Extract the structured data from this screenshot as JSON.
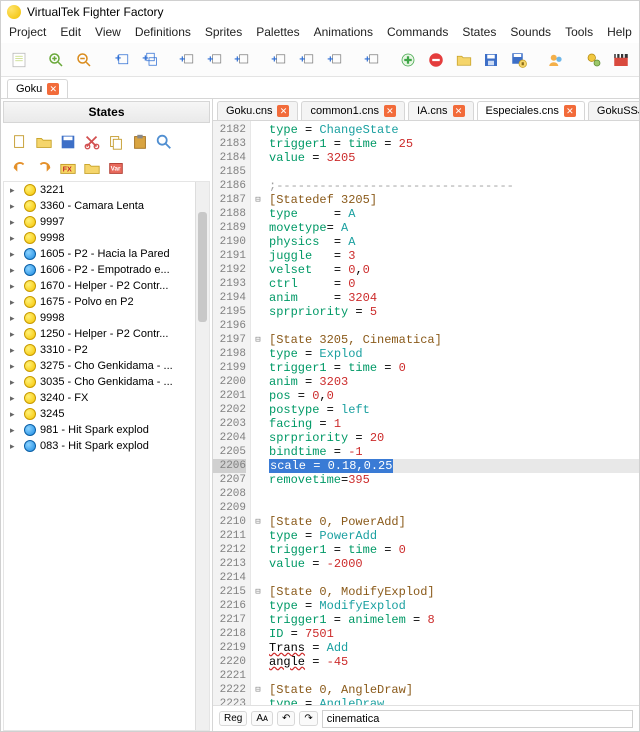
{
  "titlebar": {
    "app_title": "VirtualTek Fighter Factory"
  },
  "menus": [
    "Project",
    "Edit",
    "View",
    "Definitions",
    "Sprites",
    "Palettes",
    "Animations",
    "Commands",
    "States",
    "Sounds",
    "Tools",
    "Help"
  ],
  "top_tabs": [
    {
      "label": "Goku",
      "active": true
    }
  ],
  "states_panel": {
    "title": "States",
    "items": [
      {
        "icon": "yellow",
        "label": "3221"
      },
      {
        "icon": "yellow",
        "label": "3360 - Camara Lenta"
      },
      {
        "icon": "yellow",
        "label": "9997"
      },
      {
        "icon": "yellow",
        "label": "9998"
      },
      {
        "icon": "blue",
        "label": "1605 - P2 - Hacia la Pared"
      },
      {
        "icon": "blue",
        "label": "1606 - P2 - Empotrado e..."
      },
      {
        "icon": "yellow",
        "label": "1670 - Helper - P2 Contr..."
      },
      {
        "icon": "yellow",
        "label": "1675 - Polvo en P2"
      },
      {
        "icon": "yellow",
        "label": "9998"
      },
      {
        "icon": "yellow",
        "label": "1250 - Helper - P2 Contr..."
      },
      {
        "icon": "yellow",
        "label": "3310 - P2"
      },
      {
        "icon": "yellow",
        "label": "3275 - Cho Genkidama - ..."
      },
      {
        "icon": "yellow",
        "label": "3035 - Cho Genkidama - ..."
      },
      {
        "icon": "yellow",
        "label": "3240 - FX"
      },
      {
        "icon": "yellow",
        "label": "3245"
      },
      {
        "icon": "blue",
        "label": "981 - Hit Spark  explod"
      },
      {
        "icon": "blue",
        "label": "083 - Hit Spark  explod"
      }
    ]
  },
  "editor_tabs": [
    {
      "label": "Goku.cns",
      "active": false
    },
    {
      "label": "common1.cns",
      "active": false
    },
    {
      "label": "IA.cns",
      "active": false
    },
    {
      "label": "Especiales.cns",
      "active": true
    },
    {
      "label": "GokuSSJ.cns",
      "active": false
    }
  ],
  "code": {
    "first_line": 2182,
    "selected_line": 2206,
    "fold_lines": [
      2187,
      2197,
      2210,
      2215,
      2222
    ],
    "lines": [
      [
        [
          "green",
          "type"
        ],
        [
          "",
          " = "
        ],
        [
          "teal",
          "ChangeState"
        ]
      ],
      [
        [
          "green",
          "trigger1"
        ],
        [
          "",
          " = "
        ],
        [
          "green",
          "time"
        ],
        [
          "",
          " = "
        ],
        [
          "red",
          "25"
        ]
      ],
      [
        [
          "green",
          "value"
        ],
        [
          "",
          " = "
        ],
        [
          "red",
          "3205"
        ]
      ],
      [
        [
          "",
          ""
        ]
      ],
      [
        [
          "gray",
          ";---------------------------------"
        ]
      ],
      [
        [
          "brown",
          "[Statedef 3205]"
        ]
      ],
      [
        [
          "green",
          "type"
        ],
        [
          "",
          "     = "
        ],
        [
          "teal",
          "A"
        ]
      ],
      [
        [
          "green",
          "movetype"
        ],
        [
          "",
          "= "
        ],
        [
          "teal",
          "A"
        ]
      ],
      [
        [
          "green",
          "physics"
        ],
        [
          "",
          "  = "
        ],
        [
          "teal",
          "A"
        ]
      ],
      [
        [
          "green",
          "juggle"
        ],
        [
          "",
          "   = "
        ],
        [
          "red",
          "3"
        ]
      ],
      [
        [
          "green",
          "velset"
        ],
        [
          "",
          "   = "
        ],
        [
          "red",
          "0"
        ],
        [
          "",
          ","
        ],
        [
          "red",
          "0"
        ]
      ],
      [
        [
          "green",
          "ctrl"
        ],
        [
          "",
          "     = "
        ],
        [
          "red",
          "0"
        ]
      ],
      [
        [
          "green",
          "anim"
        ],
        [
          "",
          "     = "
        ],
        [
          "red",
          "3204"
        ]
      ],
      [
        [
          "green",
          "sprpriority"
        ],
        [
          "",
          " = "
        ],
        [
          "red",
          "5"
        ]
      ],
      [
        [
          "",
          ""
        ]
      ],
      [
        [
          "brown",
          "[State 3205, Cinematica]"
        ]
      ],
      [
        [
          "green",
          "type"
        ],
        [
          "",
          " = "
        ],
        [
          "teal",
          "Explod"
        ]
      ],
      [
        [
          "green",
          "trigger1"
        ],
        [
          "",
          " = "
        ],
        [
          "green",
          "time"
        ],
        [
          "",
          " = "
        ],
        [
          "red",
          "0"
        ]
      ],
      [
        [
          "green",
          "anim"
        ],
        [
          "",
          " = "
        ],
        [
          "red",
          "3203"
        ]
      ],
      [
        [
          "green",
          "pos"
        ],
        [
          "",
          " = "
        ],
        [
          "red",
          "0"
        ],
        [
          "",
          ","
        ],
        [
          "red",
          "0"
        ]
      ],
      [
        [
          "green",
          "postype"
        ],
        [
          "",
          " = "
        ],
        [
          "teal",
          "left"
        ]
      ],
      [
        [
          "green",
          "facing"
        ],
        [
          "",
          " = "
        ],
        [
          "red",
          "1"
        ]
      ],
      [
        [
          "green",
          "sprpriority"
        ],
        [
          "",
          " = "
        ],
        [
          "red",
          "20"
        ]
      ],
      [
        [
          "green",
          "bindtime"
        ],
        [
          "",
          " = "
        ],
        [
          "red",
          "-1"
        ]
      ],
      [
        [
          "sel",
          "scale = 0.18,0.25"
        ]
      ],
      [
        [
          "green",
          "removetime"
        ],
        [
          "",
          "="
        ],
        [
          "red",
          "395"
        ]
      ],
      [
        [
          "",
          ""
        ]
      ],
      [
        [
          "",
          ""
        ]
      ],
      [
        [
          "brown",
          "[State 0, PowerAdd]"
        ]
      ],
      [
        [
          "green",
          "type"
        ],
        [
          "",
          " = "
        ],
        [
          "teal",
          "PowerAdd"
        ]
      ],
      [
        [
          "green",
          "trigger1"
        ],
        [
          "",
          " = "
        ],
        [
          "green",
          "time"
        ],
        [
          "",
          " = "
        ],
        [
          "red",
          "0"
        ]
      ],
      [
        [
          "green",
          "value"
        ],
        [
          "",
          " = "
        ],
        [
          "red",
          "-2000"
        ]
      ],
      [
        [
          "",
          ""
        ]
      ],
      [
        [
          "brown",
          "[State 0, ModifyExplod]"
        ]
      ],
      [
        [
          "green",
          "type"
        ],
        [
          "",
          " = "
        ],
        [
          "teal",
          "ModifyExplod"
        ]
      ],
      [
        [
          "green",
          "trigger1"
        ],
        [
          "",
          " = "
        ],
        [
          "green",
          "animelem"
        ],
        [
          "",
          " = "
        ],
        [
          "red",
          "8"
        ]
      ],
      [
        [
          "green",
          "ID"
        ],
        [
          "",
          " = "
        ],
        [
          "red",
          "7501"
        ]
      ],
      [
        [
          "underl",
          "Trans"
        ],
        [
          "",
          " = "
        ],
        [
          "teal",
          "Add"
        ]
      ],
      [
        [
          "underl",
          "angle"
        ],
        [
          "",
          " = "
        ],
        [
          "red",
          "-45"
        ]
      ],
      [
        [
          "",
          ""
        ]
      ],
      [
        [
          "brown",
          "[State 0, AngleDraw]"
        ]
      ],
      [
        [
          "green",
          "type"
        ],
        [
          "",
          " = "
        ],
        [
          "teal",
          "AngleDraw"
        ]
      ]
    ]
  },
  "statusbar": {
    "reg": "Reg",
    "aa": "Aᴀ",
    "search_value": "cinematica"
  }
}
